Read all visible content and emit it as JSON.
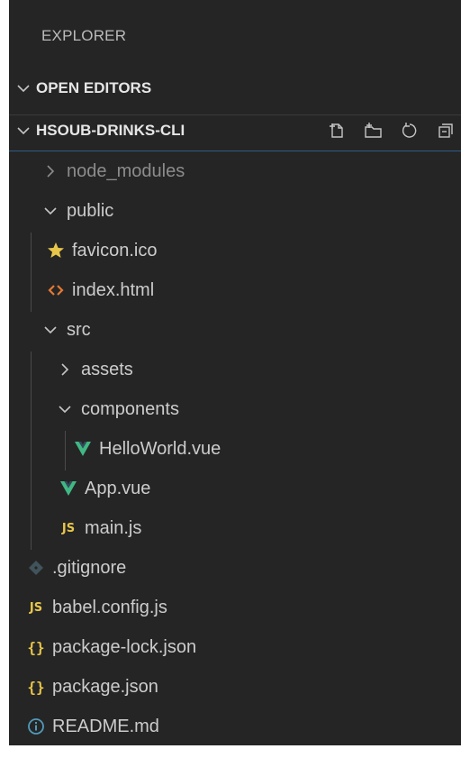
{
  "explorer": {
    "title": "EXPLORER",
    "open_editors": "OPEN EDITORS",
    "project": "HSOUB-DRINKS-CLI",
    "actions": [
      "new-file-icon",
      "new-folder-icon",
      "refresh-icon",
      "collapse-all-icon"
    ]
  },
  "tree": {
    "node_modules": "node_modules",
    "public": "public",
    "favicon": "favicon.ico",
    "index_html": "index.html",
    "src": "src",
    "assets": "assets",
    "components": "components",
    "helloworld": "HelloWorld.vue",
    "app": "App.vue",
    "main": "main.js",
    "gitignore": ".gitignore",
    "babel": "babel.config.js",
    "package_lock": "package-lock.json",
    "package": "package.json",
    "readme": "README.md"
  },
  "icons": {
    "js_label": "JS",
    "json_label": "{}"
  },
  "colors": {
    "sidebar_bg": "#252526",
    "text": "#cccccc",
    "dim_text": "#8c8c8c",
    "accent_border": "#2f5c88",
    "vue_green": "#41b883",
    "js_yellow": "#e8c64a",
    "html_orange": "#e37933",
    "info_blue": "#519aba"
  }
}
